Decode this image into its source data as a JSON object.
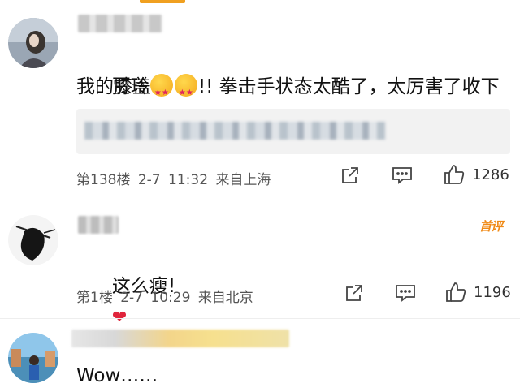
{
  "comments": [
    {
      "text_prefix": "贾玲",
      "text_suffix": "!! 拳击手状态太酷了，太厉害了收下",
      "text_line2": "我的膝盖",
      "emoji": [
        "star-struck-emoji",
        "star-struck-emoji"
      ],
      "floor": "第138楼",
      "date": "2-7 11:32",
      "location": "来自上海",
      "likes": "1286"
    },
    {
      "text": "这么瘦!",
      "emoji": "heart-emoji",
      "floor": "第1楼",
      "date": "2-7 10:29",
      "location": "来自北京",
      "likes": "1196",
      "badge": "首评"
    },
    {
      "text": "Wow……"
    }
  ],
  "colors": {
    "badge": "#f08a16",
    "heart": "#e0243b",
    "top_indicator": "#f0a020"
  }
}
